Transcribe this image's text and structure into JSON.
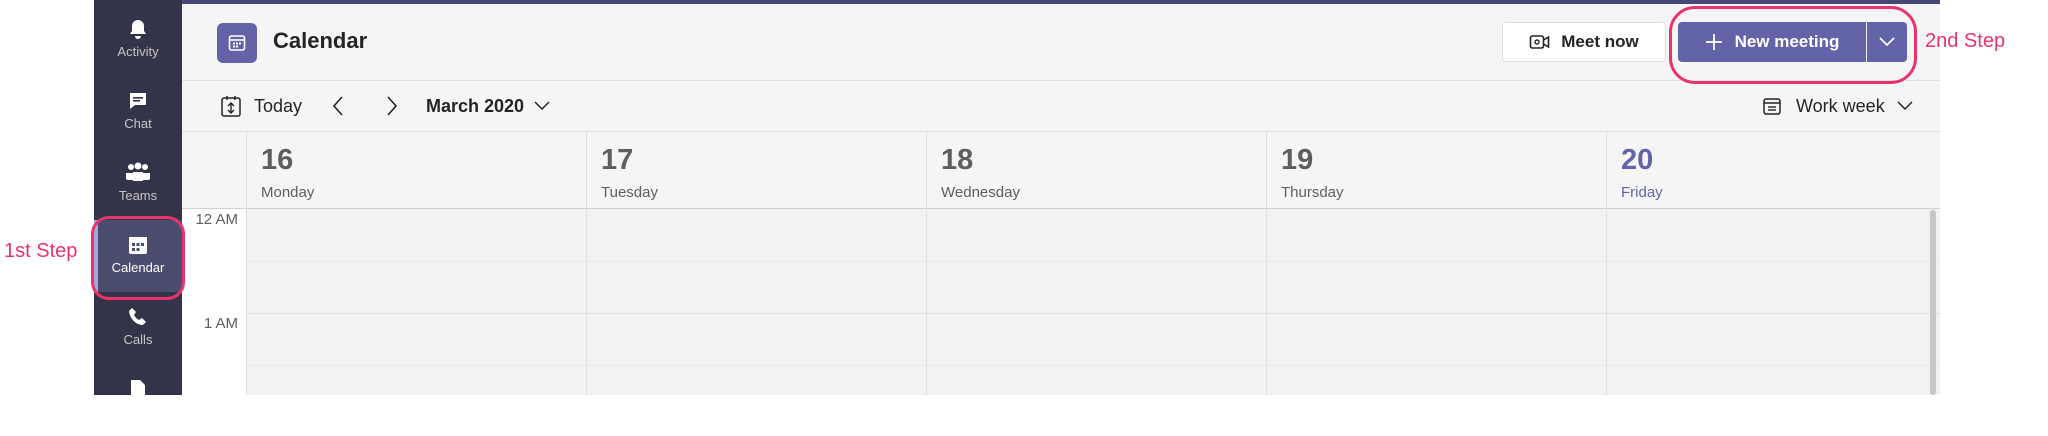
{
  "rail": {
    "items": [
      {
        "label": "Activity",
        "icon": "bell-icon"
      },
      {
        "label": "Chat",
        "icon": "chat-icon"
      },
      {
        "label": "Teams",
        "icon": "teams-icon"
      },
      {
        "label": "Calendar",
        "icon": "calendar-icon",
        "active": true
      },
      {
        "label": "Calls",
        "icon": "phone-icon"
      },
      {
        "label": "",
        "icon": "files-icon"
      }
    ]
  },
  "header": {
    "title": "Calendar",
    "meet_now_label": "Meet now",
    "new_meeting_label": "New meeting"
  },
  "toolbar": {
    "today_label": "Today",
    "month_label": "March 2020",
    "view_label": "Work week"
  },
  "days": [
    {
      "num": "16",
      "name": "Monday"
    },
    {
      "num": "17",
      "name": "Tuesday"
    },
    {
      "num": "18",
      "name": "Wednesday"
    },
    {
      "num": "19",
      "name": "Thursday"
    },
    {
      "num": "20",
      "name": "Friday",
      "today": true
    }
  ],
  "times": [
    "12 AM",
    "1 AM"
  ],
  "annotations": {
    "step1": "1st Step",
    "step2": "2nd Step"
  },
  "colors": {
    "accent": "#6264a7",
    "rail": "#33344a",
    "annotation": "#e8336f"
  }
}
